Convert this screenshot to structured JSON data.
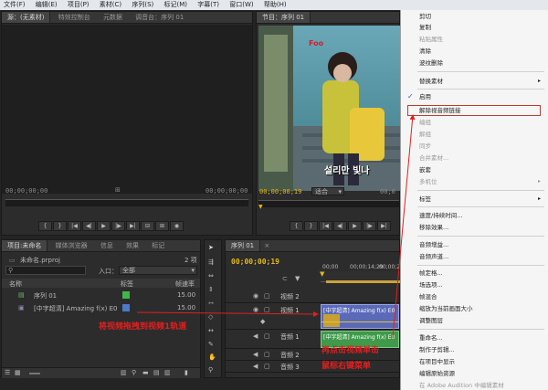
{
  "menubar": {
    "items": [
      "文件(F)",
      "编辑(E)",
      "项目(P)",
      "素材(C)",
      "序列(S)",
      "标记(M)",
      "字幕(T)",
      "窗口(W)",
      "帮助(H)"
    ]
  },
  "source_panel": {
    "tabs": [
      "源：(无素材)",
      "特效控制台",
      "元数据",
      "调音台：序列 01"
    ],
    "timecode_left": "00;00;00;00",
    "timecode_right": "00;00;00;00"
  },
  "program_panel": {
    "tab": "节目：序列 01",
    "timecode": "00;00;00;19",
    "fit_label": "适合",
    "video_logo": "Foo",
    "subtitle_text": "설리만 빛나",
    "tc_right": "00;0"
  },
  "project_panel": {
    "tabs": [
      "项目:未命名",
      "媒体浏览器",
      "信息",
      "效果",
      "标记"
    ],
    "project_file": "未命名.prproj",
    "item_count": "2 项",
    "in_label": "入口：",
    "in_value": "全部",
    "columns": {
      "name": "名称",
      "label": "标签",
      "rate": "帧速率"
    },
    "items": [
      {
        "name": "序列 01",
        "rate": "15.00",
        "label_color": "#3fb84a"
      },
      {
        "name": "[中字超清] Amazing f(x) E0",
        "rate": "15.00",
        "label_color": "#4a7ac8"
      }
    ]
  },
  "timeline": {
    "tab": "序列 01",
    "timecode": "00;00;00;19",
    "ruler": [
      "00;00",
      "00;00;14;29",
      "00;00;29;29"
    ],
    "tracks": [
      {
        "name": "视频 2"
      },
      {
        "name": "视频 1",
        "clip": "[中字超清] Amazing f(x) E0"
      },
      {
        "name": "音频 1",
        "clip": "[中字超清] Amazing f(x) E0"
      },
      {
        "name": "音频 2"
      },
      {
        "name": "音频 3"
      }
    ]
  },
  "context_menu": {
    "items": [
      {
        "label": "剪切",
        "disabled": false
      },
      {
        "label": "复制",
        "disabled": false
      },
      {
        "label": "粘贴属性",
        "disabled": true
      },
      {
        "label": "清除",
        "disabled": false
      },
      {
        "label": "波纹删除",
        "disabled": false
      },
      {
        "label": "替换素材",
        "disabled": false,
        "submenu": true
      },
      {
        "label": "启用",
        "disabled": false,
        "checked": true
      },
      {
        "label": "解除视音频链接",
        "disabled": false,
        "highlighted": true
      },
      {
        "label": "编组",
        "disabled": true
      },
      {
        "label": "解组",
        "disabled": true
      },
      {
        "label": "同步",
        "disabled": true
      },
      {
        "label": "合并素材...",
        "disabled": true
      },
      {
        "label": "嵌套",
        "disabled": false
      },
      {
        "label": "多机位",
        "disabled": true,
        "submenu": true
      },
      {
        "label": "标签",
        "disabled": false,
        "submenu": true
      },
      {
        "label": "速度/持续时间...",
        "disabled": false
      },
      {
        "label": "移除效果...",
        "disabled": false
      },
      {
        "label": "音频增益...",
        "disabled": false
      },
      {
        "label": "音频声道...",
        "disabled": false
      },
      {
        "label": "帧定格...",
        "disabled": false
      },
      {
        "label": "场选项...",
        "disabled": false
      },
      {
        "label": "帧混合",
        "disabled": false
      },
      {
        "label": "缩放为当前画面大小",
        "disabled": false
      },
      {
        "label": "调整图层",
        "disabled": false
      },
      {
        "label": "重命名...",
        "disabled": false
      },
      {
        "label": "制作子剪辑...",
        "disabled": false
      },
      {
        "label": "在项目中显示",
        "disabled": false
      },
      {
        "label": "编辑原始资源",
        "disabled": false
      },
      {
        "label": "在 Adobe Audition 中编辑素材",
        "disabled": true
      }
    ]
  },
  "annotations": {
    "drag_note": "将视频拖拽到视频1轨道",
    "rightclick_note_line1": "再点击视频单击",
    "rightclick_note_line2": "鼠标右键菜单"
  },
  "colors": {
    "accent_red": "#e02020",
    "timecode_yellow": "#e4b81a",
    "highlight_box": "#c0392b"
  }
}
